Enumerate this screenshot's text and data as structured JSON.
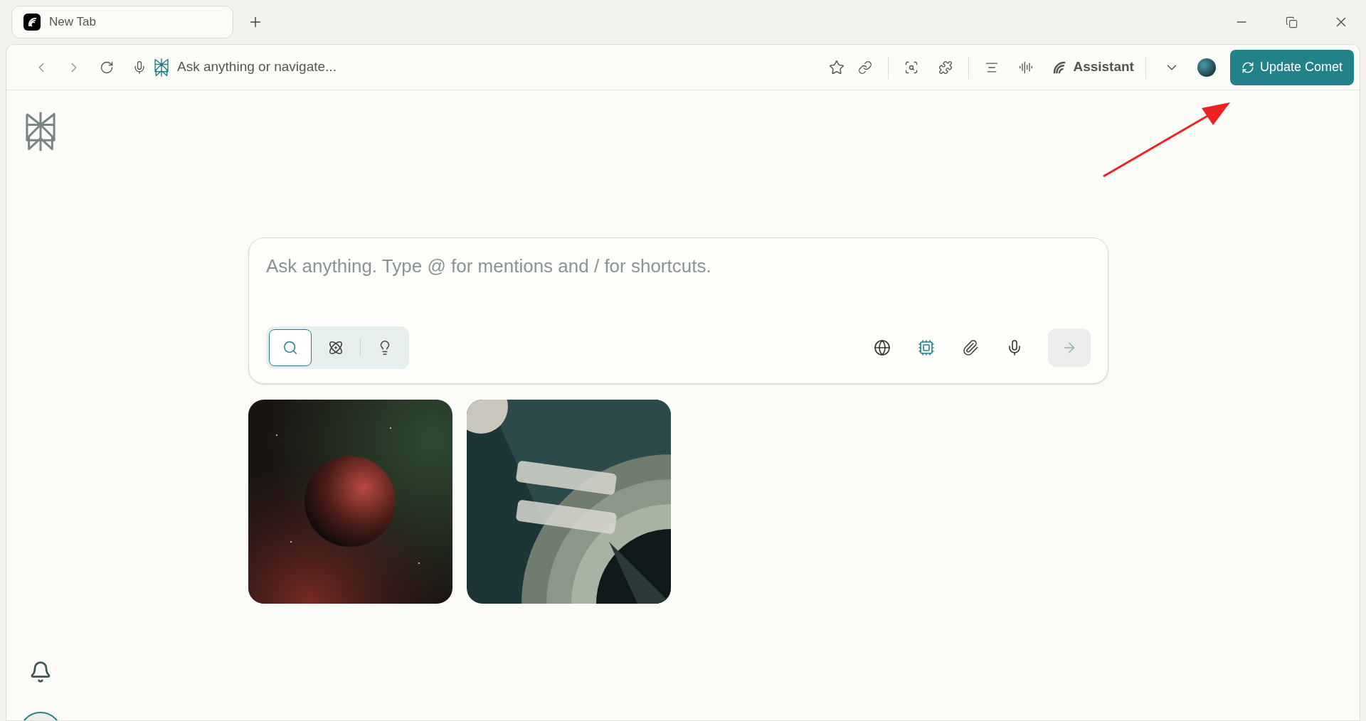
{
  "tabs": [
    {
      "title": "New Tab",
      "selected": true
    }
  ],
  "toolbar": {
    "address_placeholder": "Ask anything or navigate...",
    "assistant_label": "Assistant",
    "update_button": "Update Comet"
  },
  "search": {
    "placeholder": "Ask anything. Type @ for mentions and / for shortcuts.",
    "modes": [
      {
        "kind": "search",
        "selected": true
      },
      {
        "kind": "research",
        "selected": false
      },
      {
        "kind": "labs",
        "selected": false
      }
    ],
    "send_enabled": false
  }
}
